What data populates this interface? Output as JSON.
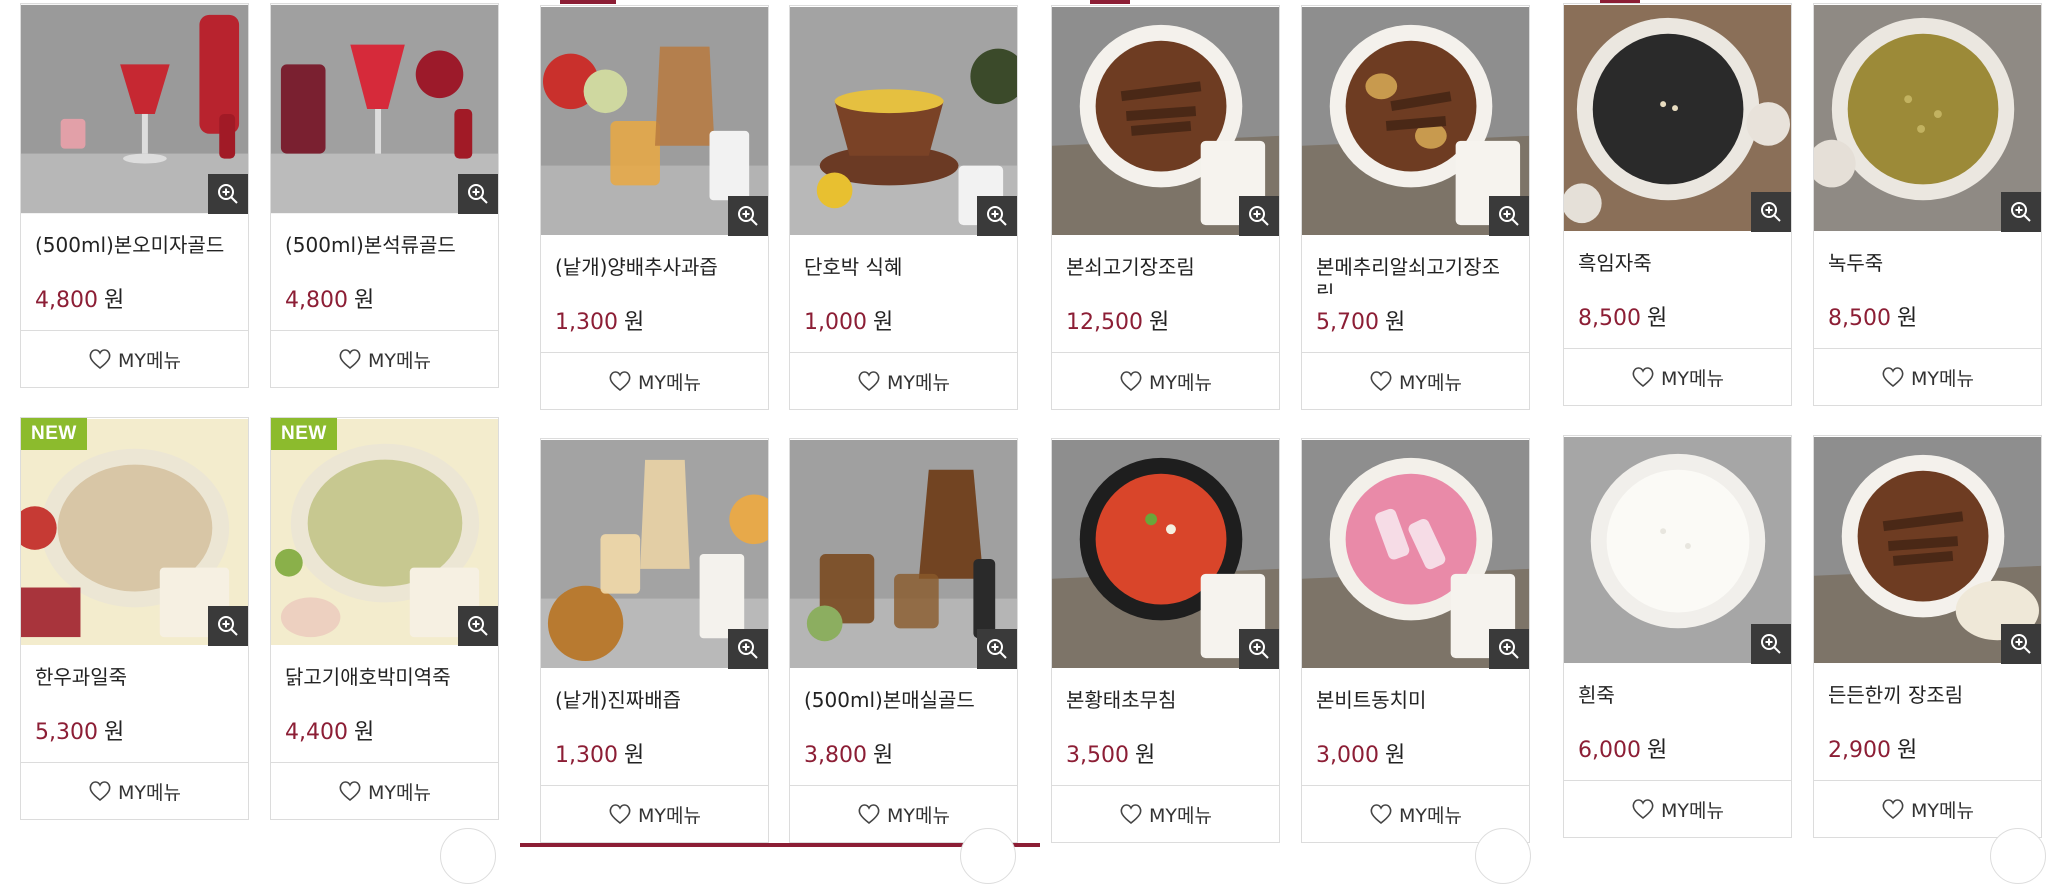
{
  "zoom_icon": "zoom-in-icon",
  "heart_icon": "heart-outline-icon",
  "colors": {
    "price": "#8c1e35",
    "new_badge": "#8cbb2d",
    "accent_bar": "#8c1e35"
  },
  "products": [
    {
      "name": "(500ml)본오미자골드",
      "price": "4,800",
      "unit": "원",
      "mymenu": "MY메뉴",
      "is_new": false
    },
    {
      "name": "(500ml)본석류골드",
      "price": "4,800",
      "unit": "원",
      "mymenu": "MY메뉴",
      "is_new": false
    },
    {
      "name": "(낱개)양배추사과즙",
      "price": "1,300",
      "unit": "원",
      "mymenu": "MY메뉴",
      "is_new": false
    },
    {
      "name": "단호박 식혜",
      "price": "1,000",
      "unit": "원",
      "mymenu": "MY메뉴",
      "is_new": false
    },
    {
      "name": "본쇠고기장조림",
      "price": "12,500",
      "unit": "원",
      "mymenu": "MY메뉴",
      "is_new": false
    },
    {
      "name": "본메추리알쇠고기장조림",
      "price": "5,700",
      "unit": "원",
      "mymenu": "MY메뉴",
      "is_new": false
    },
    {
      "name": "흑임자죽",
      "price": "8,500",
      "unit": "원",
      "mymenu": "MY메뉴",
      "is_new": false
    },
    {
      "name": "녹두죽",
      "price": "8,500",
      "unit": "원",
      "mymenu": "MY메뉴",
      "is_new": false
    },
    {
      "name": "한우과일죽",
      "price": "5,300",
      "unit": "원",
      "mymenu": "MY메뉴",
      "is_new": true,
      "badge": "NEW"
    },
    {
      "name": "닭고기애호박미역죽",
      "price": "4,400",
      "unit": "원",
      "mymenu": "MY메뉴",
      "is_new": true,
      "badge": "NEW"
    },
    {
      "name": "(낱개)진짜배즙",
      "price": "1,300",
      "unit": "원",
      "mymenu": "MY메뉴",
      "is_new": false
    },
    {
      "name": "(500ml)본매실골드",
      "price": "3,800",
      "unit": "원",
      "mymenu": "MY메뉴",
      "is_new": false
    },
    {
      "name": "본황태초무침",
      "price": "3,500",
      "unit": "원",
      "mymenu": "MY메뉴",
      "is_new": false
    },
    {
      "name": "본비트동치미",
      "price": "3,000",
      "unit": "원",
      "mymenu": "MY메뉴",
      "is_new": false
    },
    {
      "name": "흰죽",
      "price": "6,000",
      "unit": "원",
      "mymenu": "MY메뉴",
      "is_new": false
    },
    {
      "name": "든든한끼 장조림",
      "price": "2,900",
      "unit": "원",
      "mymenu": "MY메뉴",
      "is_new": false
    }
  ]
}
